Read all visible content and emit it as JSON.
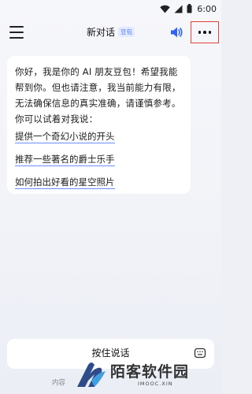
{
  "status_bar": {
    "time": "6:00",
    "icons": [
      "wifi-icon",
      "signal-icon",
      "battery-icon"
    ]
  },
  "header": {
    "title": "新对话",
    "bot_tag": "豆包",
    "icons": [
      "menu-icon",
      "speaker-icon",
      "more-icon"
    ],
    "colors": {
      "accent": "#4a72ff",
      "highlight_border": "#e0413a"
    }
  },
  "chat": {
    "greeting": "你好，我是你的 AI 朋友豆包！希望我能帮到你。但也请注意，我当前能力有限，无法确保信息的真实准确，请谨慎参考。你可以试着对我说：",
    "suggestions": [
      "提供一个奇幻小说的开头",
      "推荐一些著名的爵士乐手",
      "如何拍出好看的星空照片"
    ]
  },
  "input": {
    "hold_to_talk": "按住说话",
    "icon": "keyboard-icon"
  },
  "disclaimer": "内容",
  "watermark": {
    "text": "陌客软件园",
    "sub": "IMOOC.XIN"
  }
}
